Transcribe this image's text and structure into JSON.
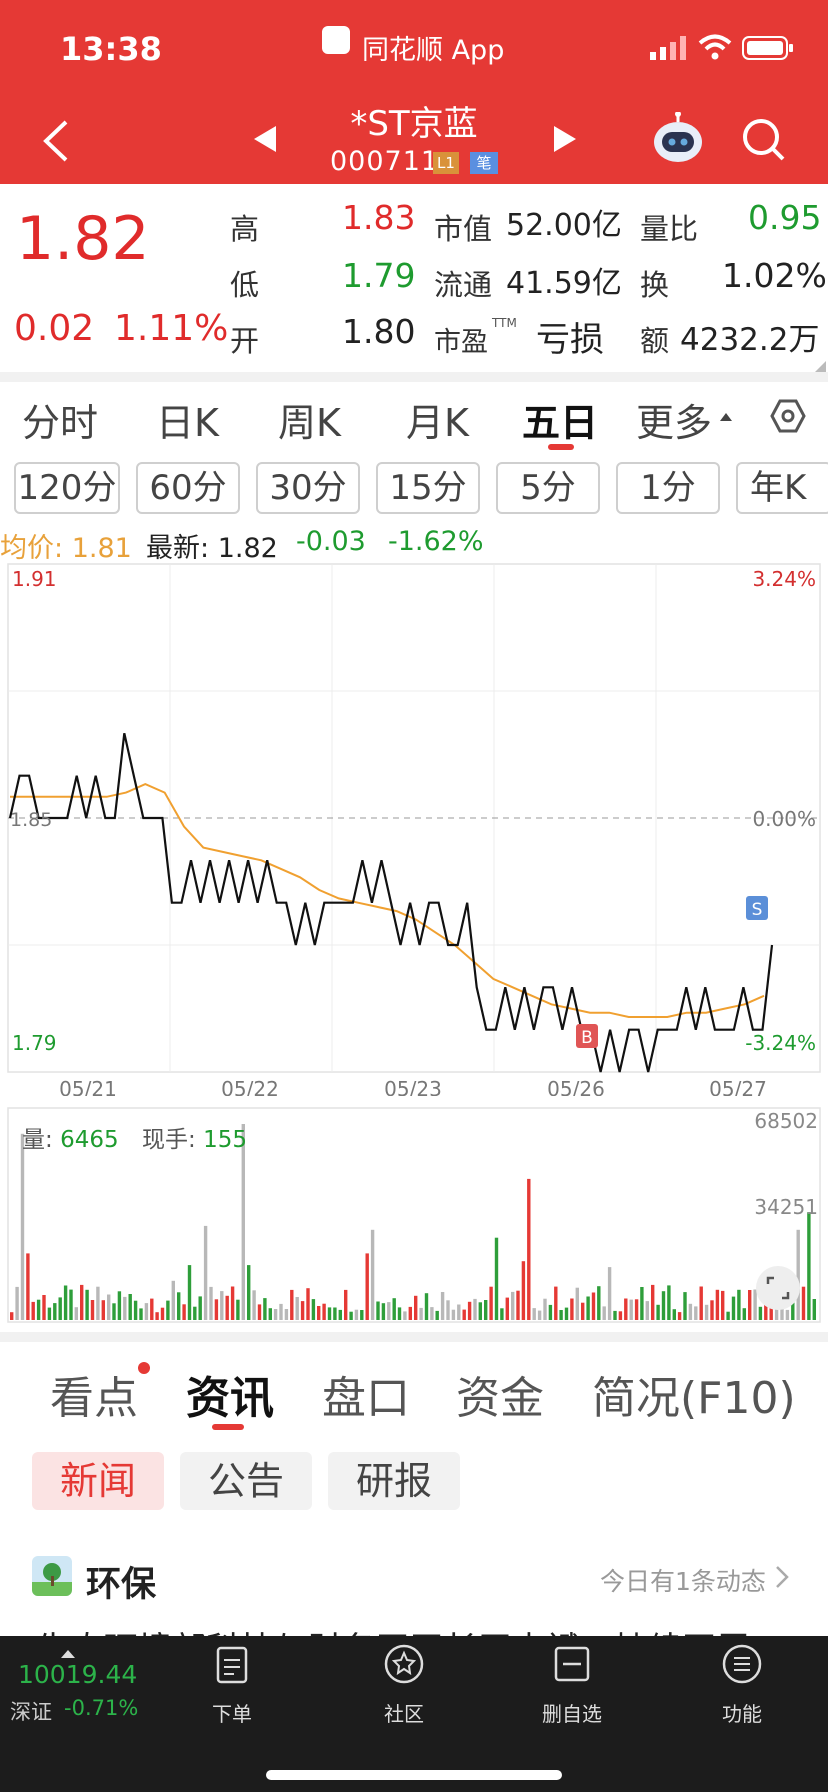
{
  "status_bar": {
    "time": "13:38",
    "app_name": "同花顺 App"
  },
  "header": {
    "stock_name": "*ST京蓝",
    "stock_code": "000711",
    "badge_l1": "L1",
    "badge_bi": "笔"
  },
  "quote": {
    "price": "1.82",
    "change": "0.02",
    "change_pct": "1.11%",
    "high_label": "高",
    "high": "1.83",
    "low_label": "低",
    "low": "1.79",
    "open_label": "开",
    "open": "1.80",
    "mktcap_label": "市值",
    "mktcap": "52.00亿",
    "float_label": "流通",
    "float": "41.59亿",
    "pe_label": "市盈",
    "pe_sup": "TTM",
    "pe": "亏损",
    "vol_ratio_label": "量比",
    "vol_ratio": "0.95",
    "turnover_label": "换",
    "turnover": "1.02%",
    "amount_label": "额",
    "amount": "4232.2万"
  },
  "tabs": [
    "分时",
    "日K",
    "周K",
    "月K",
    "五日",
    "更多"
  ],
  "period_buttons": [
    "120分",
    "60分",
    "30分",
    "15分",
    "5分",
    "1分",
    "年K"
  ],
  "chart_header": {
    "avg_label": "均价:",
    "avg": "1.81",
    "latest_label": "最新:",
    "latest": "1.82",
    "chg": "-0.03",
    "chg_pct": "-1.62%"
  },
  "chart_data": {
    "type": "line",
    "x": [
      "05/21",
      "05/22",
      "05/23",
      "05/26",
      "05/27"
    ],
    "y_labels": {
      "top": "1.91",
      "bottom": "1.79",
      "mid": "1.85",
      "pct_top": "3.24%",
      "pct_mid": "0.00%",
      "pct_bottom": "-3.24%"
    },
    "ylim": [
      1.79,
      1.91
    ],
    "series": [
      {
        "values": [
          1.85,
          1.86,
          1.86,
          1.85,
          1.85,
          1.85,
          1.85,
          1.86,
          1.85,
          1.86,
          1.85,
          1.85,
          1.87,
          1.86,
          1.85,
          1.85,
          1.85,
          1.83,
          1.83,
          1.84,
          1.83,
          1.84,
          1.83,
          1.84,
          1.83,
          1.84,
          1.83,
          1.84,
          1.83,
          1.83,
          1.82,
          1.83,
          1.82,
          1.83,
          1.83,
          1.83,
          1.83,
          1.84,
          1.83,
          1.84,
          1.83,
          1.82,
          1.83,
          1.82,
          1.83,
          1.83,
          1.82,
          1.82,
          1.83,
          1.81,
          1.8,
          1.8,
          1.81,
          1.8,
          1.81,
          1.8,
          1.81,
          1.81,
          1.8,
          1.81,
          1.8,
          1.8,
          1.79,
          1.8,
          1.79,
          1.8,
          1.8,
          1.79,
          1.8,
          1.8,
          1.8,
          1.81,
          1.8,
          1.81,
          1.8,
          1.8,
          1.8,
          1.81,
          1.8,
          1.8,
          1.82
        ]
      },
      {
        "values": [
          1.855,
          1.855,
          1.855,
          1.855,
          1.855,
          1.855,
          1.856,
          1.858,
          1.856,
          1.848,
          1.843,
          1.842,
          1.841,
          1.84,
          1.838,
          1.836,
          1.833,
          1.831,
          1.83,
          1.829,
          1.828,
          1.826,
          1.823,
          1.82,
          1.816,
          1.812,
          1.81,
          1.808,
          1.806,
          1.805,
          1.804,
          1.804,
          1.803,
          1.803,
          1.803,
          1.804,
          1.804,
          1.805,
          1.806,
          1.808
        ]
      }
    ],
    "volume_labels": {
      "max": "68502",
      "mid": "34251"
    }
  },
  "volume_header": {
    "vol_label": "量:",
    "vol": "6465",
    "hand_label": "现手:",
    "hand": "155"
  },
  "bottom_tabs": [
    "看点",
    "资讯",
    "盘口",
    "资金",
    "简况(F10)"
  ],
  "chips": [
    "新闻",
    "公告",
    "研报"
  ],
  "news": {
    "title": "环保",
    "more": "今日有1条动态",
    "snippet": "生态环境部科技与财务司司长王志斌：持续开展"
  },
  "footer": {
    "index_value": "10019.44",
    "index_name": "深证",
    "index_chg": "-0.71%",
    "items": [
      "下单",
      "社区",
      "删自选",
      "功能"
    ]
  }
}
